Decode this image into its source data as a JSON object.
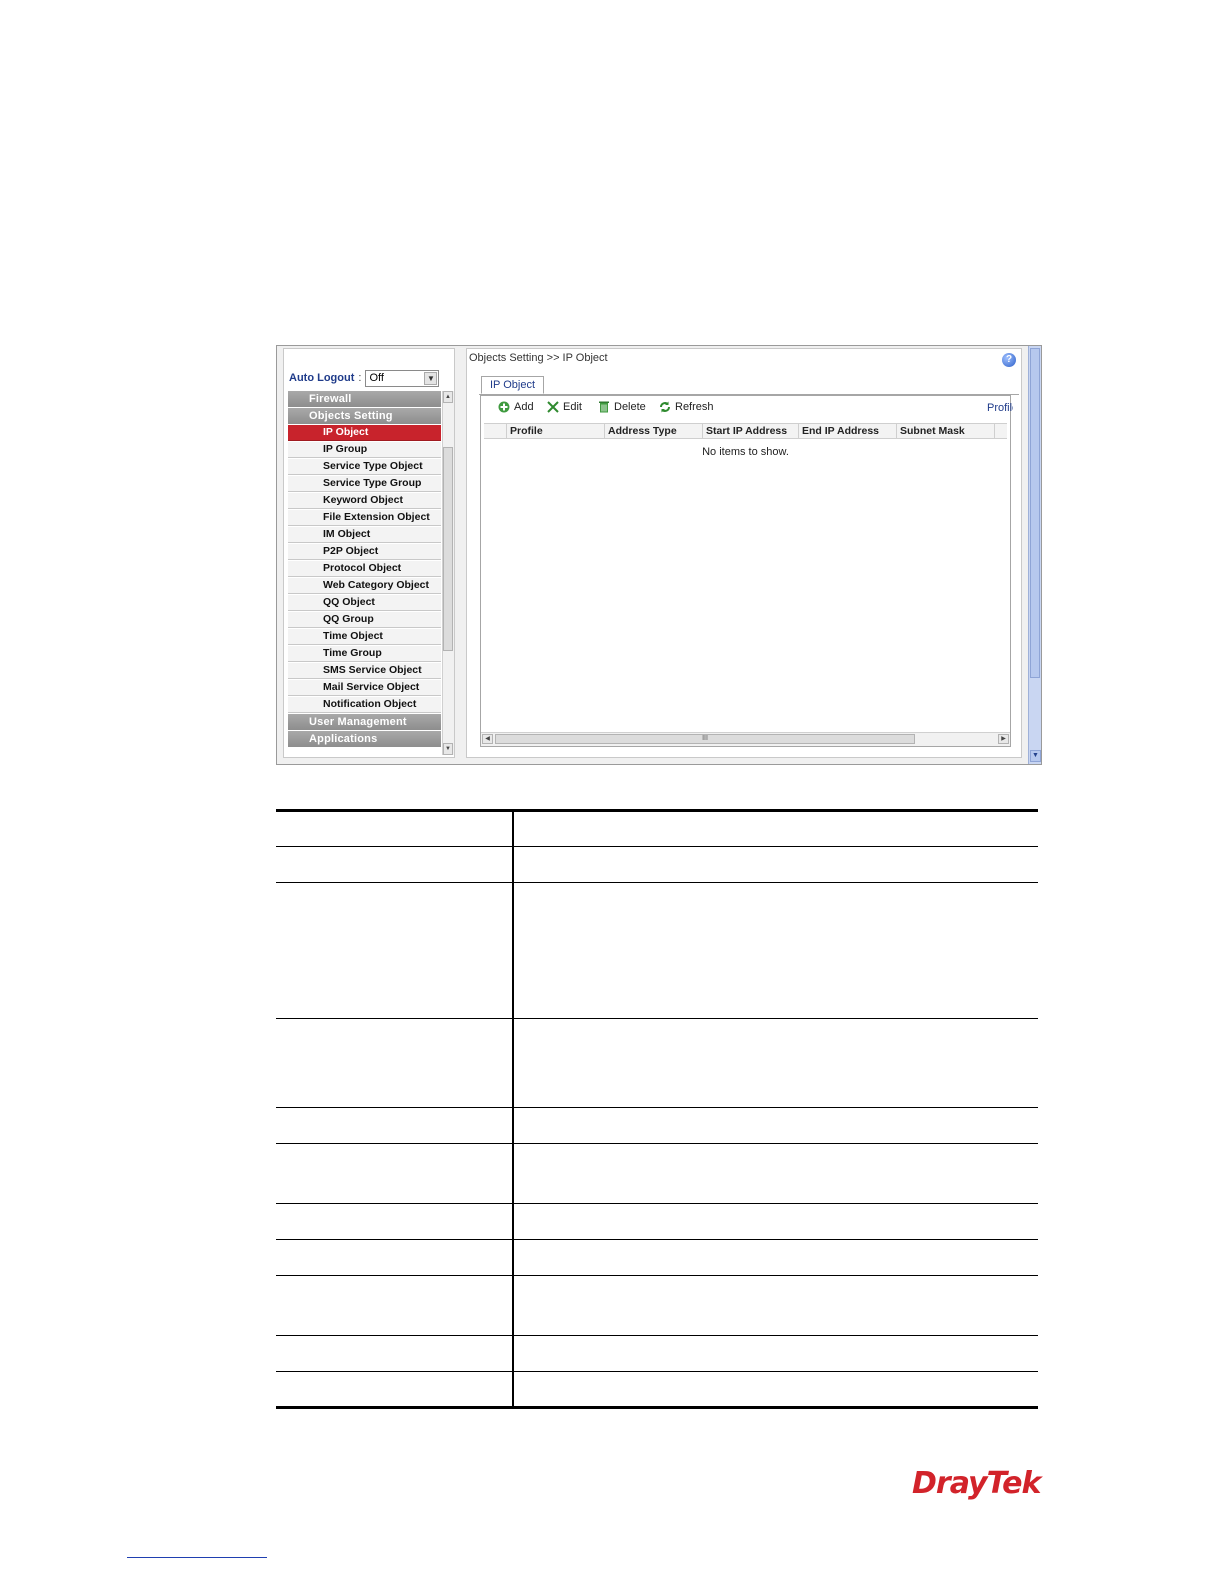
{
  "auto_logout": {
    "label": "Auto Logout",
    "separator": ":",
    "value": "Off"
  },
  "menu": [
    {
      "type": "category",
      "label": "Firewall"
    },
    {
      "type": "category",
      "label": "Objects Setting"
    },
    {
      "type": "item",
      "label": "IP Object",
      "active": true
    },
    {
      "type": "item",
      "label": "IP Group"
    },
    {
      "type": "item",
      "label": "Service Type Object"
    },
    {
      "type": "item",
      "label": "Service Type Group"
    },
    {
      "type": "item",
      "label": "Keyword Object"
    },
    {
      "type": "item",
      "label": "File Extension Object"
    },
    {
      "type": "item",
      "label": "IM Object"
    },
    {
      "type": "item",
      "label": "P2P Object"
    },
    {
      "type": "item",
      "label": "Protocol Object"
    },
    {
      "type": "item",
      "label": "Web Category Object"
    },
    {
      "type": "item",
      "label": "QQ Object"
    },
    {
      "type": "item",
      "label": "QQ Group"
    },
    {
      "type": "item",
      "label": "Time Object"
    },
    {
      "type": "item",
      "label": "Time Group"
    },
    {
      "type": "item",
      "label": "SMS Service Object"
    },
    {
      "type": "item",
      "label": "Mail Service Object"
    },
    {
      "type": "item",
      "label": "Notification Object"
    },
    {
      "type": "category",
      "label": "User Management"
    },
    {
      "type": "category",
      "label": "Applications"
    }
  ],
  "breadcrumb": "Objects Setting >> IP Object",
  "help_icon": "help-icon",
  "tab": {
    "label": "IP Object"
  },
  "toolbar": {
    "add": "Add",
    "edit": "Edit",
    "delete": "Delete",
    "refresh": "Refresh",
    "profile_truncated": "Profile"
  },
  "grid": {
    "columns": [
      "Profile",
      "Address Type",
      "Start IP Address",
      "End IP Address",
      "Subnet Mask"
    ],
    "empty_text": "No items to show.",
    "scroll_grip": "III"
  },
  "brand": {
    "logo": "DrayTek",
    "color": "#d2232a"
  },
  "colors": {
    "active_menu": "#c8232c",
    "link_blue": "#1f3b8a"
  }
}
